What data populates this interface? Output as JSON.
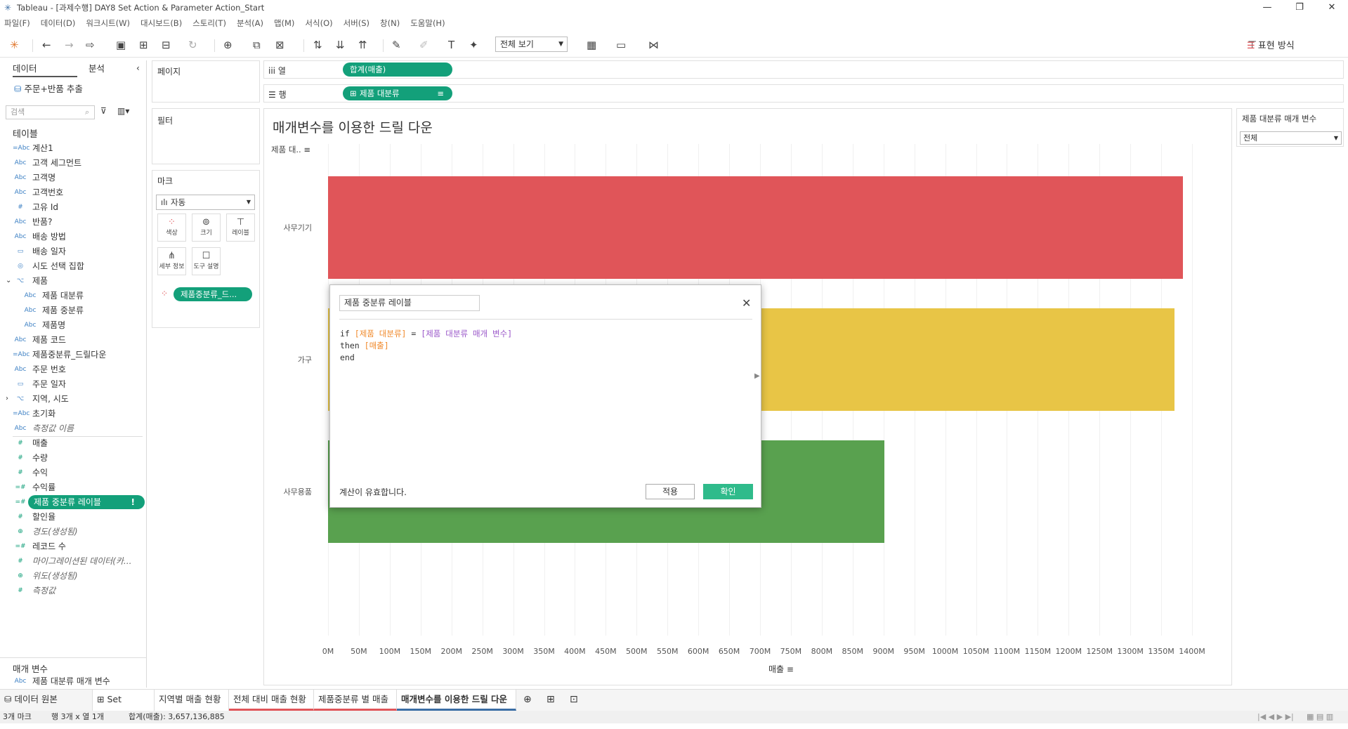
{
  "window": {
    "title": "Tableau - [과제수행] DAY8 Set Action & Parameter Action_Start"
  },
  "menu": [
    "파일(F)",
    "데이터(D)",
    "워크시트(W)",
    "대시보드(B)",
    "스토리(T)",
    "분석(A)",
    "맵(M)",
    "서식(O)",
    "서버(S)",
    "창(N)",
    "도움말(H)"
  ],
  "toolbar": {
    "view_select": "전체 보기",
    "show_me": "표현 방식"
  },
  "data_pane": {
    "tab_data": "데이터",
    "tab_analysis": "분석",
    "datasource": "주문+반품 추출",
    "search_placeholder": "검색",
    "tables_header": "테이블",
    "fields": [
      {
        "icon": "=Abc",
        "label": "계산1"
      },
      {
        "icon": "Abc",
        "label": "고객 세그먼트"
      },
      {
        "icon": "Abc",
        "label": "고객명"
      },
      {
        "icon": "Abc",
        "label": "고객번호"
      },
      {
        "icon": "#",
        "label": "고유 Id"
      },
      {
        "icon": "Abc",
        "label": "반품?"
      },
      {
        "icon": "Abc",
        "label": "배송 방법"
      },
      {
        "icon": "▭",
        "label": "배송 일자"
      },
      {
        "icon": "◎",
        "label": "시도 선택 집합"
      },
      {
        "icon": "⌥",
        "label": "제품"
      },
      {
        "icon": "Abc",
        "label": "제품 대분류"
      },
      {
        "icon": "Abc",
        "label": "제품 중분류"
      },
      {
        "icon": "Abc",
        "label": "제품명"
      },
      {
        "icon": "Abc",
        "label": "제품 코드"
      },
      {
        "icon": "=Abc",
        "label": "제품중분류_드릴다운"
      },
      {
        "icon": "Abc",
        "label": "주문 번호"
      },
      {
        "icon": "▭",
        "label": "주문 일자"
      },
      {
        "icon": "⌥",
        "label": "지역, 시도"
      },
      {
        "icon": "=Abc",
        "label": "초기화"
      },
      {
        "icon": "Abc",
        "label": "측정값 이름"
      },
      {
        "icon": "#",
        "label": "매출"
      },
      {
        "icon": "#",
        "label": "수량"
      },
      {
        "icon": "#",
        "label": "수익"
      },
      {
        "icon": "=#",
        "label": "수익률"
      },
      {
        "icon": "=#",
        "label": "제품 중분류 레이블"
      },
      {
        "icon": "#",
        "label": "할인율"
      },
      {
        "icon": "⊕",
        "label": "경도(생성됨)"
      },
      {
        "icon": "=#",
        "label": "레코드 수"
      },
      {
        "icon": "#",
        "label": "마이그레이션된 데이터(카..."
      },
      {
        "icon": "⊕",
        "label": "위도(생성됨)"
      },
      {
        "icon": "#",
        "label": "측정값"
      }
    ],
    "params_header": "매개 변수",
    "param_field": "제품 대분류 매개 변수"
  },
  "shelves": {
    "pages": "페이지",
    "filters": "필터",
    "marks": "마크",
    "columns_label": "열",
    "columns_pill": "합계(매출)",
    "rows_label": "행",
    "rows_pill": "제품 대분류",
    "mark_type": "자동",
    "mark_color": "색상",
    "mark_size": "크기",
    "mark_label": "레이블",
    "mark_detail": "세부 정보",
    "mark_tooltip": "도구 설명",
    "mark_pill": "제품중분류_드..."
  },
  "view": {
    "title": "매개변수를 이용한 드릴 다운",
    "row_header": "제품 대..",
    "x_axis_title": "매출"
  },
  "chart_data": {
    "type": "bar",
    "orientation": "horizontal",
    "categories": [
      "사무기기",
      "가구",
      "사무용품"
    ],
    "values": [
      1385000000,
      1371000000,
      901000000
    ],
    "colors": [
      "#e05559",
      "#e8c546",
      "#59a14f"
    ],
    "xlabel": "매출",
    "xlim": [
      0,
      1400000000
    ],
    "ticks": [
      "0M",
      "50M",
      "100M",
      "150M",
      "200M",
      "250M",
      "300M",
      "350M",
      "400M",
      "450M",
      "500M",
      "550M",
      "600M",
      "650M",
      "700M",
      "750M",
      "800M",
      "850M",
      "900M",
      "950M",
      "1000M",
      "1050M",
      "1100M",
      "1150M",
      "1200M",
      "1250M",
      "1300M",
      "1350M",
      "1400M"
    ]
  },
  "parameter_panel": {
    "title": "제품 대분류 매개 변수",
    "value": "전체"
  },
  "calc_dialog": {
    "name": "제품 중분류 레이블",
    "code_if": "if",
    "code_field1": "[제품 대분류]",
    "code_eq": "=",
    "code_param": "[제품 대분류 매개 변수]",
    "code_then": "then",
    "code_field2": "[매출]",
    "code_end": "end",
    "status": "계산이 유효합니다.",
    "apply": "적용",
    "ok": "확인"
  },
  "sheet_tabs": [
    "데이터 원본",
    "Set Action",
    "지역별 매출 현황",
    "전체 대비 매출 현황",
    "제품중분류 별 매출",
    "매개변수를 이용한 드릴 다운"
  ],
  "status_bar": {
    "marks": "3개 마크",
    "rows_cols": "행 3개 x 열 1개",
    "sum": "합계(매출): 3,657,136,885"
  }
}
